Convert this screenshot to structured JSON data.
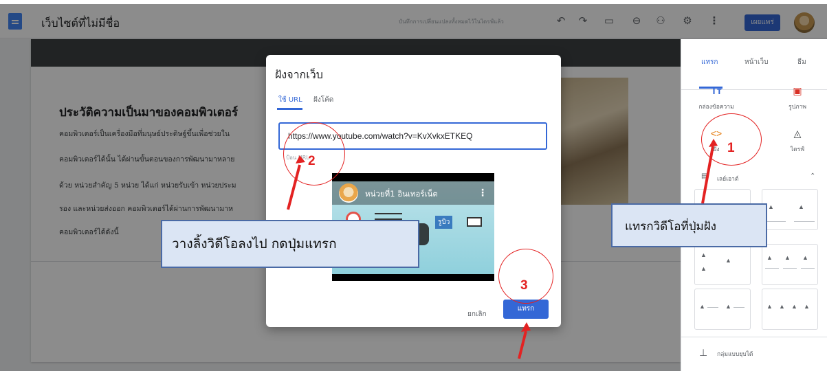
{
  "topbar": {
    "site_title": "เว็บไซต์ที่ไม่มีชื่อ",
    "save_status": "บันทึกการเปลี่ยนแปลงทั้งหมดไว้ในไดรฟ์แล้ว",
    "publish_label": "เผยแพร่",
    "icons": [
      "site-icon",
      "undo-icon",
      "redo-icon",
      "preview-icon",
      "link-icon",
      "share-icon",
      "settings-icon",
      "more-icon"
    ]
  },
  "page": {
    "heading": "ประวัติความเป็นมาของคอมพิวเตอร์",
    "lines": [
      "คอมพิวเตอร์เป็นเครื่องมือที่มนุษย์ประดิษฐ์ขึ้นเพื่อช่วยใน",
      "คอมพิวเตอร์ได้นั้น ได้ผ่านขั้นตอนของการพัฒนามาหลาย",
      "ด้วย หน่วยสำคัญ 5 หน่วย ได้แก่ หน่วยรับเข้า หน่วยประม",
      "รอง และหน่วยส่งออก คอมพิวเตอร์ได้ผ่านการพัฒนามาห",
      "คอมพิวเตอร์ได้ดังนี้"
    ]
  },
  "right_panel": {
    "tabs": [
      "แทรก",
      "หน้าเว็บ",
      "ธีม"
    ],
    "active_tab": "แทรก",
    "insert_items": [
      {
        "icon": "Tт",
        "label": "กล่องข้อความ"
      },
      {
        "icon": "▣",
        "label": "รูปภาพ"
      },
      {
        "icon": "<>",
        "label": "ฝัง"
      },
      {
        "icon": "◬",
        "label": "ไดรฟ์"
      }
    ],
    "layouts_label": "เลย์เอาต์",
    "collapsible_label": "กลุ่มแบบยุบได้"
  },
  "dialog": {
    "title": "ฝังจากเว็บ",
    "tabs": [
      "ใช้ URL",
      "ฝังโค้ด"
    ],
    "active_tab": "ใช้ URL",
    "url_value": "https://www.youtube.com/watch?v=KvXvkxETKEQ",
    "url_helper": "ป้อน URL",
    "video": {
      "title": "หน่วยที่1 อินเทอร์เน็ต",
      "badge": "รูบิว"
    },
    "cancel_label": "ยกเลิก",
    "insert_label": "แทรก"
  },
  "annotations": {
    "callout_paste": "วางลิ้งวิดีโอลงไป กดปุ่มแทรก",
    "callout_embed": "แทรกวิดีโอที่ปุ่มฝัง",
    "step_1": "1",
    "step_2": "2",
    "step_3": "3",
    "accent_color": "#e32222"
  }
}
